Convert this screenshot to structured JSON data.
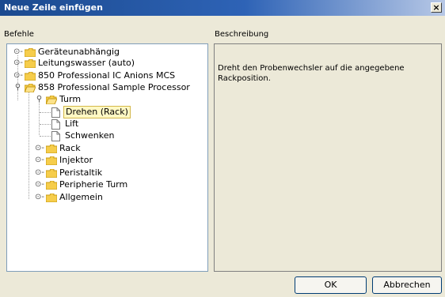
{
  "window": {
    "title": "Neue Zeile einfügen",
    "close_glyph": "×"
  },
  "left_pane": {
    "label": "Befehle"
  },
  "right_pane": {
    "label": "Beschreibung",
    "description": "Dreht den Probenwechsler auf die angegebene Rackposition."
  },
  "tree": {
    "items": [
      {
        "label": "Geräteunabhängig"
      },
      {
        "label": "Leitungswasser (auto)"
      },
      {
        "label": "850 Professional IC Anions MCS"
      },
      {
        "label": "858 Professional Sample Processor"
      },
      {
        "label": "Turm"
      },
      {
        "label": "Drehen (Rack)"
      },
      {
        "label": "Lift"
      },
      {
        "label": "Schwenken"
      },
      {
        "label": "Rack"
      },
      {
        "label": "Injektor"
      },
      {
        "label": "Peristaltik"
      },
      {
        "label": "Peripherie Turm"
      },
      {
        "label": "Allgemein"
      }
    ]
  },
  "buttons": {
    "ok": "OK",
    "cancel": "Abbrechen"
  }
}
